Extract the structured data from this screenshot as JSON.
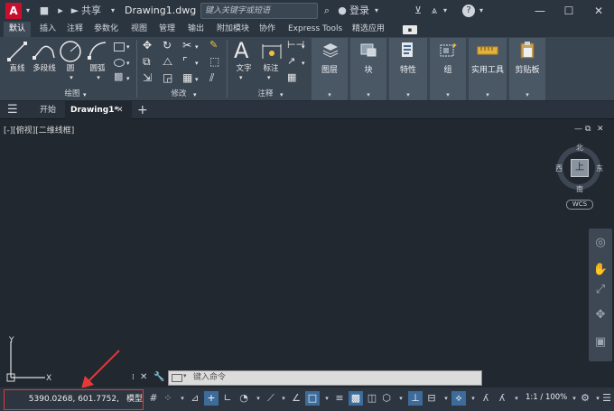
{
  "titlebar": {
    "logo": "A",
    "share": "共享",
    "doc_title": "Drawing1.dwg",
    "search_placeholder": "键入关键字或短语",
    "login": "登录"
  },
  "ribbon_tabs": [
    "默认",
    "插入",
    "注释",
    "参数化",
    "视图",
    "管理",
    "输出",
    "附加模块",
    "协作",
    "Express Tools",
    "精选应用"
  ],
  "panels": {
    "draw": {
      "title": "绘图",
      "tools": [
        "直线",
        "多段线",
        "圆",
        "圆弧"
      ]
    },
    "modify": {
      "title": "修改"
    },
    "annotation": {
      "title": "注释",
      "tools": [
        "文字",
        "标注"
      ]
    },
    "tiles": [
      "图层",
      "块",
      "特性",
      "组",
      "实用工具",
      "剪贴板"
    ]
  },
  "file_tabs": {
    "start": "开始",
    "active": "Drawing1*"
  },
  "viewport": {
    "label": "[-][俯视][二维线框]",
    "north": "北",
    "south": "南",
    "east": "东",
    "west": "西",
    "face": "上",
    "wcs": "WCS"
  },
  "command_line": {
    "placeholder": "键入命令"
  },
  "statusbar": {
    "coordinates": "5390.0268, 601.7752, 0.0000",
    "model": "模型",
    "scale": "1:1 / 100%"
  },
  "colors": {
    "accent_red": "#c8102e",
    "highlight_border": "#e53935",
    "active_toggle": "#3d6b9a"
  }
}
